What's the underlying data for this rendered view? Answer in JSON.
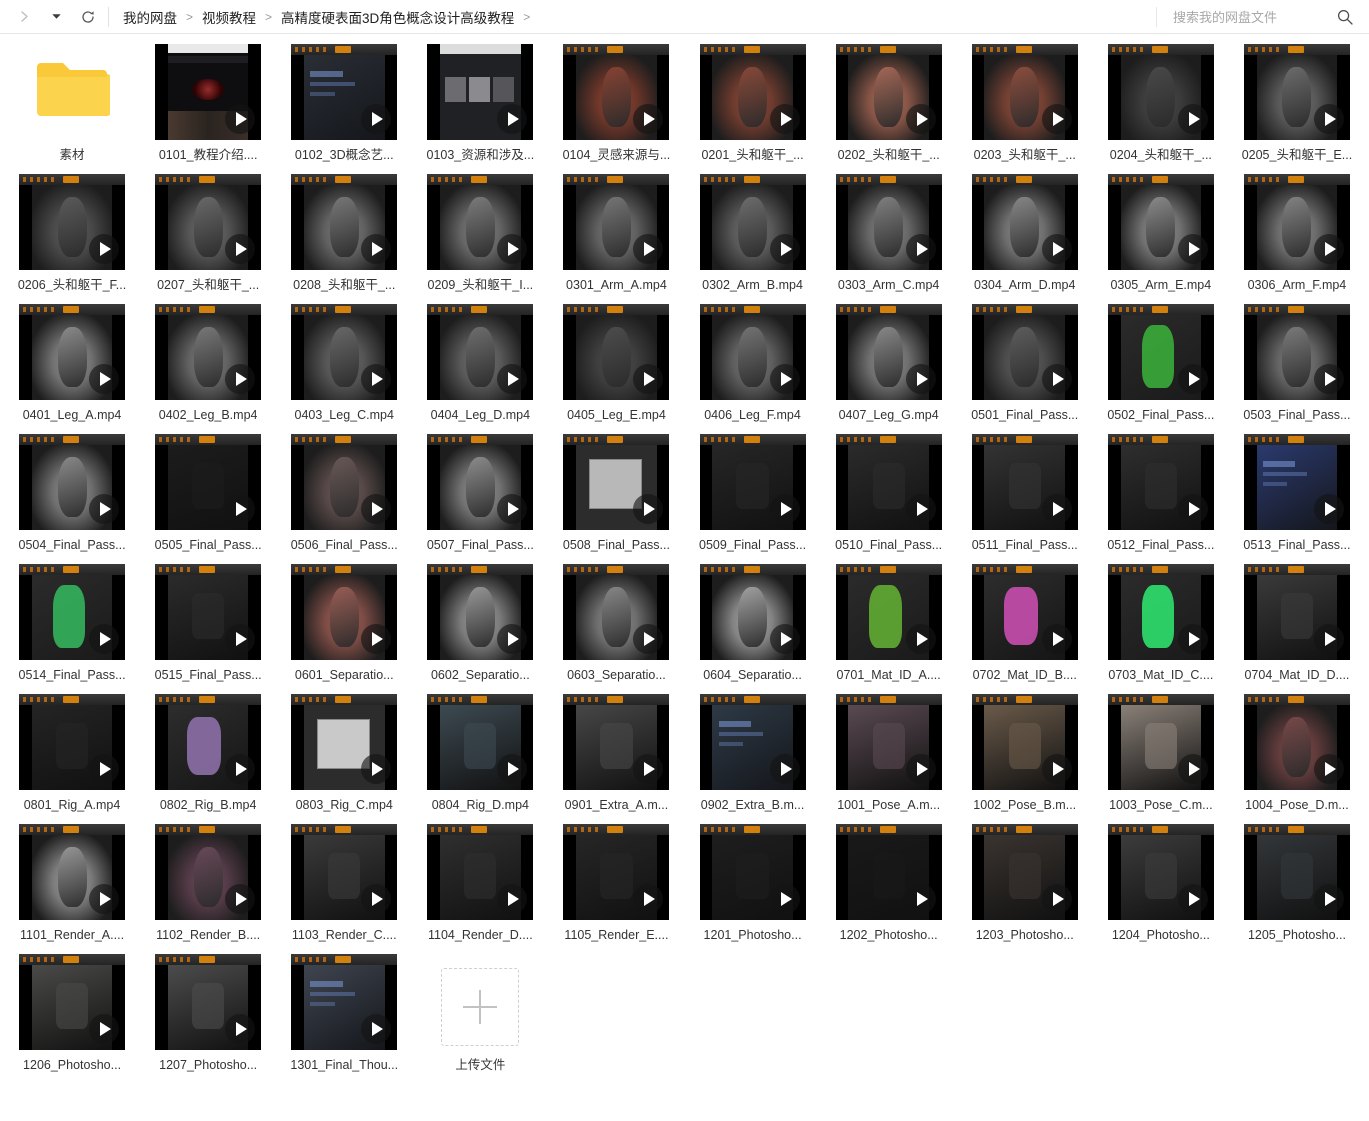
{
  "toolbar": {
    "forward_icon": "chevron-right-icon",
    "dropdown_icon": "caret-down-icon",
    "refresh_icon": "refresh-icon",
    "search_icon": "search-icon",
    "search_placeholder": "搜索我的网盘文件",
    "search_value": ""
  },
  "breadcrumb": {
    "items": [
      {
        "label": "我的网盘"
      },
      {
        "label": "视频教程"
      },
      {
        "label": "高精度硬表面3D角色概念设计高级教程"
      }
    ],
    "separator": ">",
    "trailing_separator": ">"
  },
  "upload": {
    "label": "上传文件",
    "icon": "plus-icon"
  },
  "colors": {
    "folder": "#fbd34d",
    "folder_tab": "#f9c93a",
    "accent": "#06a7ff",
    "video_bg": "#000000",
    "text": "#333333"
  },
  "files": [
    {
      "name": "素材",
      "type": "folder"
    },
    {
      "name": "0101_教程介绍....",
      "type": "video",
      "tone": "#1b1b1d",
      "scene": "browser-dark"
    },
    {
      "name": "0102_3D概念艺...",
      "type": "video",
      "tone": "#2a2e35",
      "scene": "ui-blue"
    },
    {
      "name": "0103_资源和涉及...",
      "type": "video",
      "tone": "#3a3d42",
      "scene": "gallery"
    },
    {
      "name": "0104_灵感来源与...",
      "type": "video",
      "tone": "#8a4434",
      "scene": "sculpt-red"
    },
    {
      "name": "0201_头和躯干_...",
      "type": "video",
      "tone": "#8a4a3a",
      "scene": "sculpt-red"
    },
    {
      "name": "0202_头和躯干_...",
      "type": "video",
      "tone": "#a86a58",
      "scene": "sculpt-red"
    },
    {
      "name": "0203_头和躯干_...",
      "type": "video",
      "tone": "#8e4f3f",
      "scene": "sculpt-red"
    },
    {
      "name": "0204_头和躯干_...",
      "type": "video",
      "tone": "#4a4a4a",
      "scene": "sculpt-grey"
    },
    {
      "name": "0205_头和躯干_E...",
      "type": "video",
      "tone": "#6e6e6e",
      "scene": "sculpt-grey"
    },
    {
      "name": "0206_头和躯干_F...",
      "type": "video",
      "tone": "#5c5c5c",
      "scene": "sculpt-grey"
    },
    {
      "name": "0207_头和躯干_...",
      "type": "video",
      "tone": "#6b6b6b",
      "scene": "sculpt-grey"
    },
    {
      "name": "0208_头和躯干_...",
      "type": "video",
      "tone": "#7a7a7a",
      "scene": "sculpt-grey"
    },
    {
      "name": "0209_头和躯干_I...",
      "type": "video",
      "tone": "#7e7e7e",
      "scene": "sculpt-grey"
    },
    {
      "name": "0301_Arm_A.mp4",
      "type": "video",
      "tone": "#787878",
      "scene": "sculpt-grey"
    },
    {
      "name": "0302_Arm_B.mp4",
      "type": "video",
      "tone": "#6f6f6f",
      "scene": "sculpt-grey"
    },
    {
      "name": "0303_Arm_C.mp4",
      "type": "video",
      "tone": "#828282",
      "scene": "sculpt-grey"
    },
    {
      "name": "0304_Arm_D.mp4",
      "type": "video",
      "tone": "#8a8a8a",
      "scene": "sculpt-grey"
    },
    {
      "name": "0305_Arm_E.mp4",
      "type": "video",
      "tone": "#8d8d8d",
      "scene": "sculpt-grey"
    },
    {
      "name": "0306_Arm_F.mp4",
      "type": "video",
      "tone": "#868686",
      "scene": "sculpt-grey"
    },
    {
      "name": "0401_Leg_A.mp4",
      "type": "video",
      "tone": "#8e8e8e",
      "scene": "sculpt-grey"
    },
    {
      "name": "0402_Leg_B.mp4",
      "type": "video",
      "tone": "#7b7b7b",
      "scene": "sculpt-grey"
    },
    {
      "name": "0403_Leg_C.mp4",
      "type": "video",
      "tone": "#6a6a6a",
      "scene": "sculpt-grey"
    },
    {
      "name": "0404_Leg_D.mp4",
      "type": "video",
      "tone": "#707070",
      "scene": "sculpt-grey"
    },
    {
      "name": "0405_Leg_E.mp4",
      "type": "video",
      "tone": "#4e4e4e",
      "scene": "sculpt-grey"
    },
    {
      "name": "0406_Leg_F.mp4",
      "type": "video",
      "tone": "#767676",
      "scene": "sculpt-grey"
    },
    {
      "name": "0407_Leg_G.mp4",
      "type": "video",
      "tone": "#8b8b8b",
      "scene": "sculpt-grey"
    },
    {
      "name": "0501_Final_Pass...",
      "type": "video",
      "tone": "#5f5f5f",
      "scene": "sculpt-grey"
    },
    {
      "name": "0502_Final_Pass...",
      "type": "video",
      "tone": "#3aa83a",
      "scene": "ui-green"
    },
    {
      "name": "0503_Final_Pass...",
      "type": "video",
      "tone": "#7d7d7d",
      "scene": "sculpt-grey"
    },
    {
      "name": "0504_Final_Pass...",
      "type": "video",
      "tone": "#8c8c8c",
      "scene": "sculpt-grey"
    },
    {
      "name": "0505_Final_Pass...",
      "type": "video",
      "tone": "#1c1c1c",
      "scene": "dark-ui"
    },
    {
      "name": "0506_Final_Pass...",
      "type": "video",
      "tone": "#6b5a58",
      "scene": "sculpt-red"
    },
    {
      "name": "0507_Final_Pass...",
      "type": "video",
      "tone": "#8f8f8f",
      "scene": "sculpt-grey"
    },
    {
      "name": "0508_Final_Pass...",
      "type": "video",
      "tone": "#b8b8b8",
      "scene": "dialog"
    },
    {
      "name": "0509_Final_Pass...",
      "type": "video",
      "tone": "#262626",
      "scene": "dark-ui"
    },
    {
      "name": "0510_Final_Pass...",
      "type": "video",
      "tone": "#2b2b2b",
      "scene": "dark-ui"
    },
    {
      "name": "0511_Final_Pass...",
      "type": "video",
      "tone": "#333333",
      "scene": "dark-ui"
    },
    {
      "name": "0512_Final_Pass...",
      "type": "video",
      "tone": "#2e2e2e",
      "scene": "dark-ui"
    },
    {
      "name": "0513_Final_Pass...",
      "type": "video",
      "tone": "#2b3a6e",
      "scene": "ui-blue"
    },
    {
      "name": "0514_Final_Pass...",
      "type": "video",
      "tone": "#34b05a",
      "scene": "ui-green"
    },
    {
      "name": "0515_Final_Pass...",
      "type": "video",
      "tone": "#2b2b2b",
      "scene": "dark-ui"
    },
    {
      "name": "0601_Separatio...",
      "type": "video",
      "tone": "#9b5f56",
      "scene": "sculpt-red"
    },
    {
      "name": "0602_Separatio...",
      "type": "video",
      "tone": "#9a9a9a",
      "scene": "sculpt-grey"
    },
    {
      "name": "0603_Separatio...",
      "type": "video",
      "tone": "#8a8a8a",
      "scene": "sculpt-grey"
    },
    {
      "name": "0604_Separatio...",
      "type": "video",
      "tone": "#a5a5a5",
      "scene": "sculpt-grey"
    },
    {
      "name": "0701_Mat_ID_A....",
      "type": "video",
      "tone": "#5fa832",
      "scene": "ui-green"
    },
    {
      "name": "0702_Mat_ID_B....",
      "type": "video",
      "tone": "#c84fae",
      "scene": "ui-magenta"
    },
    {
      "name": "0703_Mat_ID_C....",
      "type": "video",
      "tone": "#2fdc6b",
      "scene": "ui-green"
    },
    {
      "name": "0704_Mat_ID_D....",
      "type": "video",
      "tone": "#3a3a3a",
      "scene": "dark-ui"
    },
    {
      "name": "0801_Rig_A.mp4",
      "type": "video",
      "tone": "#242424",
      "scene": "dark-ui"
    },
    {
      "name": "0802_Rig_B.mp4",
      "type": "video",
      "tone": "#8d6fa8",
      "scene": "ui-magenta"
    },
    {
      "name": "0803_Rig_C.mp4",
      "type": "video",
      "tone": "#c9c9c9",
      "scene": "dialog"
    },
    {
      "name": "0804_Rig_D.mp4",
      "type": "video",
      "tone": "#3d4a52",
      "scene": "dark-ui"
    },
    {
      "name": "0901_Extra_A.m...",
      "type": "video",
      "tone": "#474747",
      "scene": "dark-ui"
    },
    {
      "name": "0902_Extra_B.m...",
      "type": "video",
      "tone": "#2e3a46",
      "scene": "ui-blue"
    },
    {
      "name": "1001_Pose_A.m...",
      "type": "video",
      "tone": "#5a4a52",
      "scene": "dark-ui"
    },
    {
      "name": "1002_Pose_B.m...",
      "type": "video",
      "tone": "#6a5a4a",
      "scene": "dark-ui"
    },
    {
      "name": "1003_Pose_C.m...",
      "type": "video",
      "tone": "#8a8078",
      "scene": "dark-ui"
    },
    {
      "name": "1004_Pose_D.m...",
      "type": "video",
      "tone": "#7a4a4a",
      "scene": "sculpt-red"
    },
    {
      "name": "1101_Render_A....",
      "type": "video",
      "tone": "#9a9a9a",
      "scene": "sculpt-grey"
    },
    {
      "name": "1102_Render_B....",
      "type": "video",
      "tone": "#6a4a5a",
      "scene": "sculpt-red"
    },
    {
      "name": "1103_Render_C....",
      "type": "video",
      "tone": "#3a3a3a",
      "scene": "dark-ui"
    },
    {
      "name": "1104_Render_D....",
      "type": "video",
      "tone": "#2f2f2f",
      "scene": "dark-ui"
    },
    {
      "name": "1105_Render_E....",
      "type": "video",
      "tone": "#262626",
      "scene": "dark-ui"
    },
    {
      "name": "1201_Photosho...",
      "type": "video",
      "tone": "#1e1e1e",
      "scene": "dark-ui"
    },
    {
      "name": "1202_Photosho...",
      "type": "video",
      "tone": "#191919",
      "scene": "dark-ui"
    },
    {
      "name": "1203_Photosho...",
      "type": "video",
      "tone": "#3a3430",
      "scene": "dark-ui"
    },
    {
      "name": "1204_Photosho...",
      "type": "video",
      "tone": "#3c3c3c",
      "scene": "dark-ui"
    },
    {
      "name": "1205_Photosho...",
      "type": "video",
      "tone": "#33373a",
      "scene": "dark-ui"
    },
    {
      "name": "1206_Photosho...",
      "type": "video",
      "tone": "#4a4a48",
      "scene": "dark-ui"
    },
    {
      "name": "1207_Photosho...",
      "type": "video",
      "tone": "#4c4c4c",
      "scene": "dark-ui"
    },
    {
      "name": "1301_Final_Thou...",
      "type": "video",
      "tone": "#3f4550",
      "scene": "ui-blue"
    }
  ]
}
